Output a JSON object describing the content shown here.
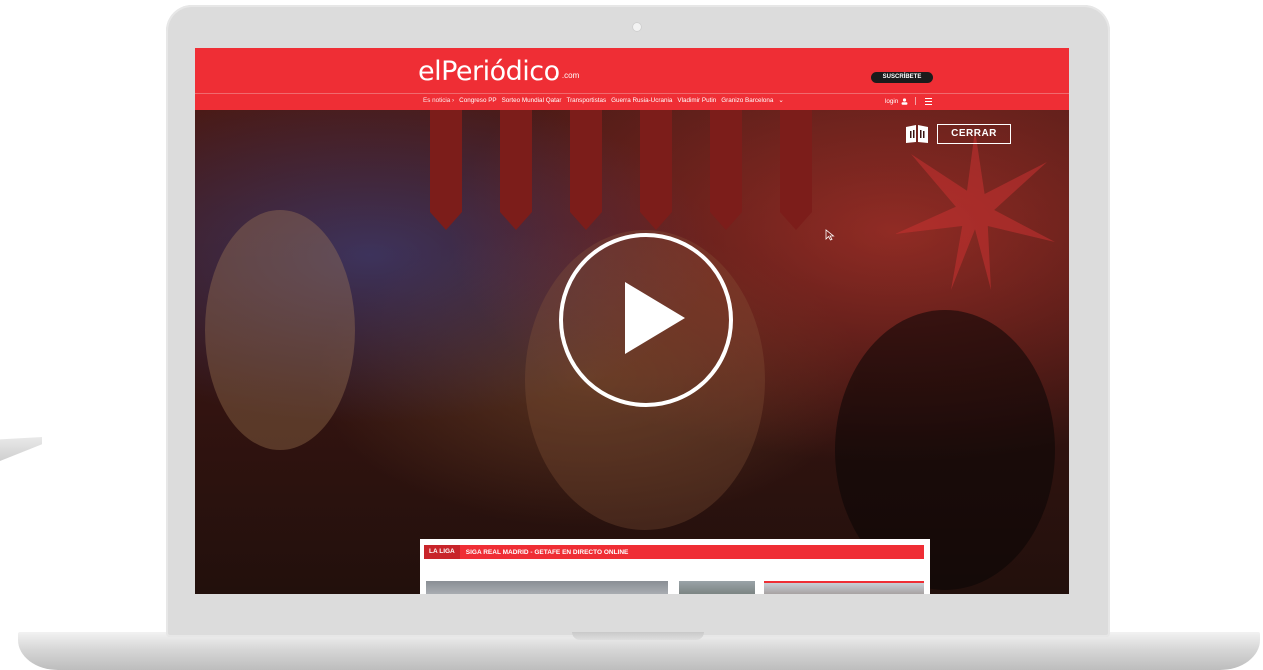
{
  "site": {
    "logo": "elPeriódico",
    "logo_suffix": "⌄ .com",
    "subscribe": "SUSCRÍBETE",
    "login": "login",
    "brand_color": "#ef2e35"
  },
  "nav": {
    "items": [
      "Es noticia ›",
      "Congreso PP",
      "Sorteo Mundial Qatar",
      "Transportistas",
      "Guerra Rusia-Ucrania",
      "Vladimir Putin",
      "Granizo Barcelona",
      "⌄"
    ]
  },
  "video": {
    "close_label": "CERRAR",
    "play_icon": "play-icon",
    "book_icon": "book-icon"
  },
  "banner": {
    "tag": "LA LIGA",
    "text": "SIGA REAL MADRID - GETAFE EN DIRECTO ONLINE"
  }
}
